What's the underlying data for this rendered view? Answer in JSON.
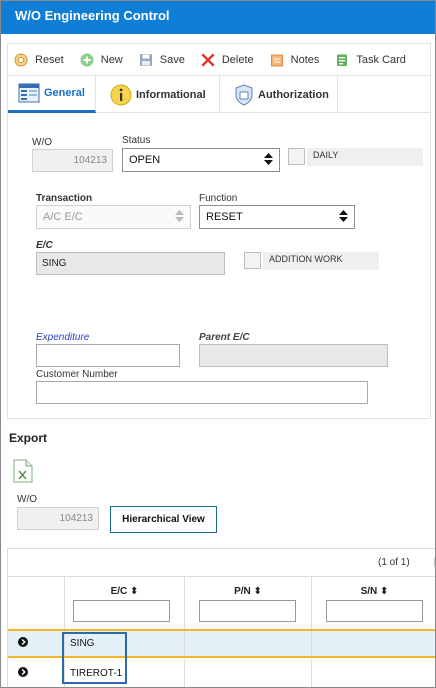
{
  "window": {
    "title": "W/O Engineering Control"
  },
  "toolbar": {
    "reset": "Reset",
    "new": "New",
    "save": "Save",
    "delete": "Delete",
    "notes": "Notes",
    "task_card": "Task Card"
  },
  "tabs": [
    {
      "label": "General",
      "active": true
    },
    {
      "label": "Informational",
      "active": false
    },
    {
      "label": "Authorization",
      "active": false
    }
  ],
  "general": {
    "wo_label": "W/O",
    "wo_value": "104213",
    "status_label": "Status",
    "status_value": "OPEN",
    "daily_label": "DAILY",
    "transaction_label": "Transaction",
    "transaction_value": "A/C E/C",
    "function_label": "Function",
    "function_value": "RESET",
    "ec_label": "E/C",
    "ec_value": "SING",
    "addition_work_label": "ADDITION WORK",
    "expenditure_label": "Expenditure",
    "expenditure_value": "",
    "parent_ec_label": "Parent E/C",
    "parent_ec_value": "",
    "customer_number_label": "Customer Number",
    "customer_number_value": ""
  },
  "export": {
    "title": "Export",
    "wo_label": "W/O",
    "wo_value": "104213",
    "hierarchical_view_button": "Hierarchical View"
  },
  "grid": {
    "pager_text": "(1 of 1)",
    "columns": [
      "E/C",
      "P/N",
      "S/N"
    ],
    "rows": [
      {
        "ec": "SING",
        "pn": "",
        "sn": "",
        "selected": true
      },
      {
        "ec": "TIREROT-1",
        "pn": "",
        "sn": "",
        "selected": false
      }
    ]
  },
  "colors": {
    "title_bar": "#0f7ed6",
    "active_tab": "#1a6fc0",
    "selected_row": "#e4f1f8",
    "row_highlight_border": "#f0b429",
    "focus_border": "#2e6aa8"
  }
}
